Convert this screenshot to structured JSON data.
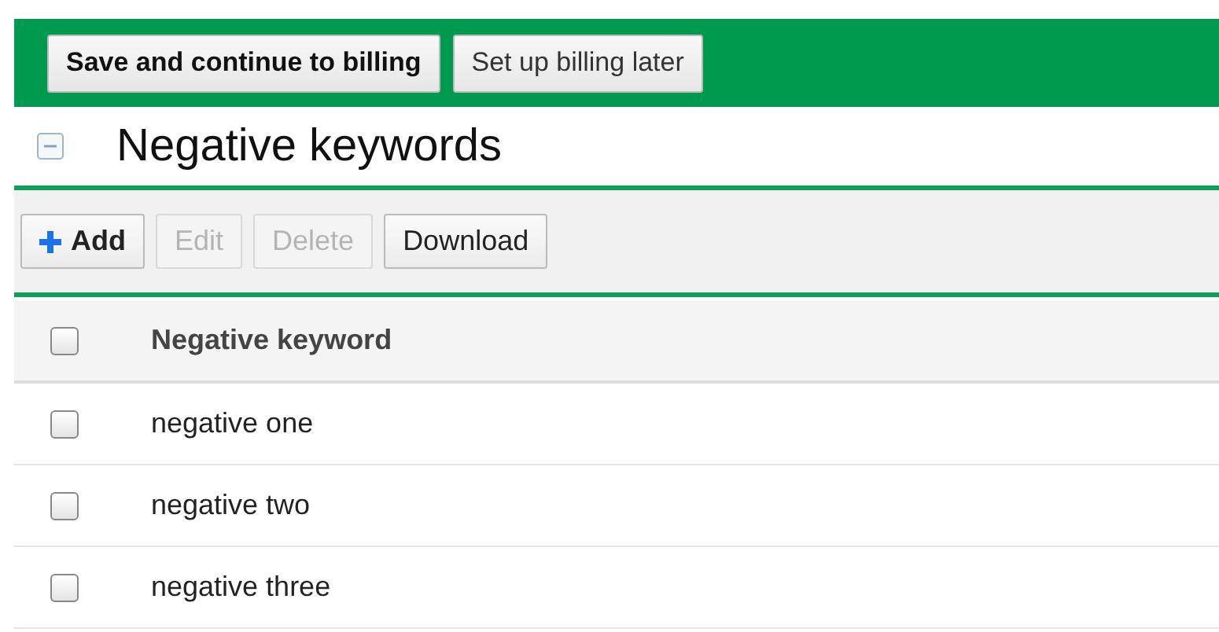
{
  "action_bar": {
    "buttons": [
      {
        "label": "Save and continue to billing",
        "primary": true
      },
      {
        "label": "Set up billing later",
        "primary": false
      }
    ]
  },
  "section": {
    "title": "Negative keywords",
    "expanded": true
  },
  "toolbar": {
    "buttons": [
      {
        "label": "Add",
        "kind": "add",
        "disabled": false
      },
      {
        "label": "Edit",
        "kind": "plain",
        "disabled": true
      },
      {
        "label": "Delete",
        "kind": "plain",
        "disabled": true
      },
      {
        "label": "Download",
        "kind": "plain",
        "disabled": false
      }
    ]
  },
  "table": {
    "header": {
      "label": "Negative keyword",
      "checked": false
    },
    "rows": [
      {
        "keyword": "negative one",
        "checked": false
      },
      {
        "keyword": "negative two",
        "checked": false
      },
      {
        "keyword": "negative three",
        "checked": false
      }
    ]
  }
}
